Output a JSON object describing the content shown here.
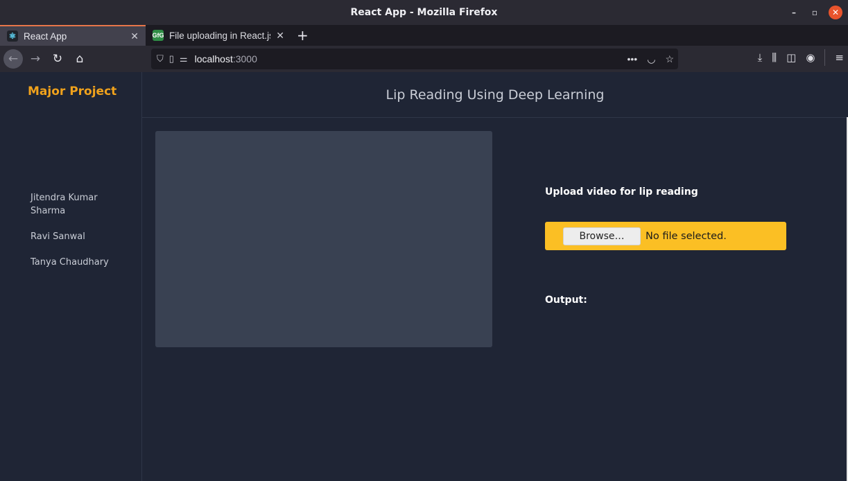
{
  "window": {
    "title": "React App - Mozilla Firefox",
    "controls": {
      "minimize": "–",
      "restore": "▫",
      "close": "✕"
    }
  },
  "tabs": [
    {
      "label": "React App",
      "favicon": "react-icon",
      "active": true
    },
    {
      "label": "File uploading in React.js",
      "favicon": "gfg-icon",
      "active": false
    }
  ],
  "tab_favicon_gfg_text": "GfG",
  "navbar": {
    "url_host": "localhost",
    "url_port": ":3000"
  },
  "sidebar": {
    "brand": "Major Project",
    "members": [
      "Jitendra Kumar Sharma",
      "Ravi Sanwal",
      "Tanya Chaudhary"
    ]
  },
  "header": {
    "title": "Lip Reading Using Deep Learning"
  },
  "upload": {
    "label": "Upload video for lip reading",
    "browse_label": "Browse…",
    "status": "No file selected."
  },
  "output": {
    "label": "Output:"
  },
  "colors": {
    "brand": "#f0a21c",
    "file_input_bg": "#fbbf24",
    "page_bg": "#1f2535",
    "video_box": "#394152"
  }
}
